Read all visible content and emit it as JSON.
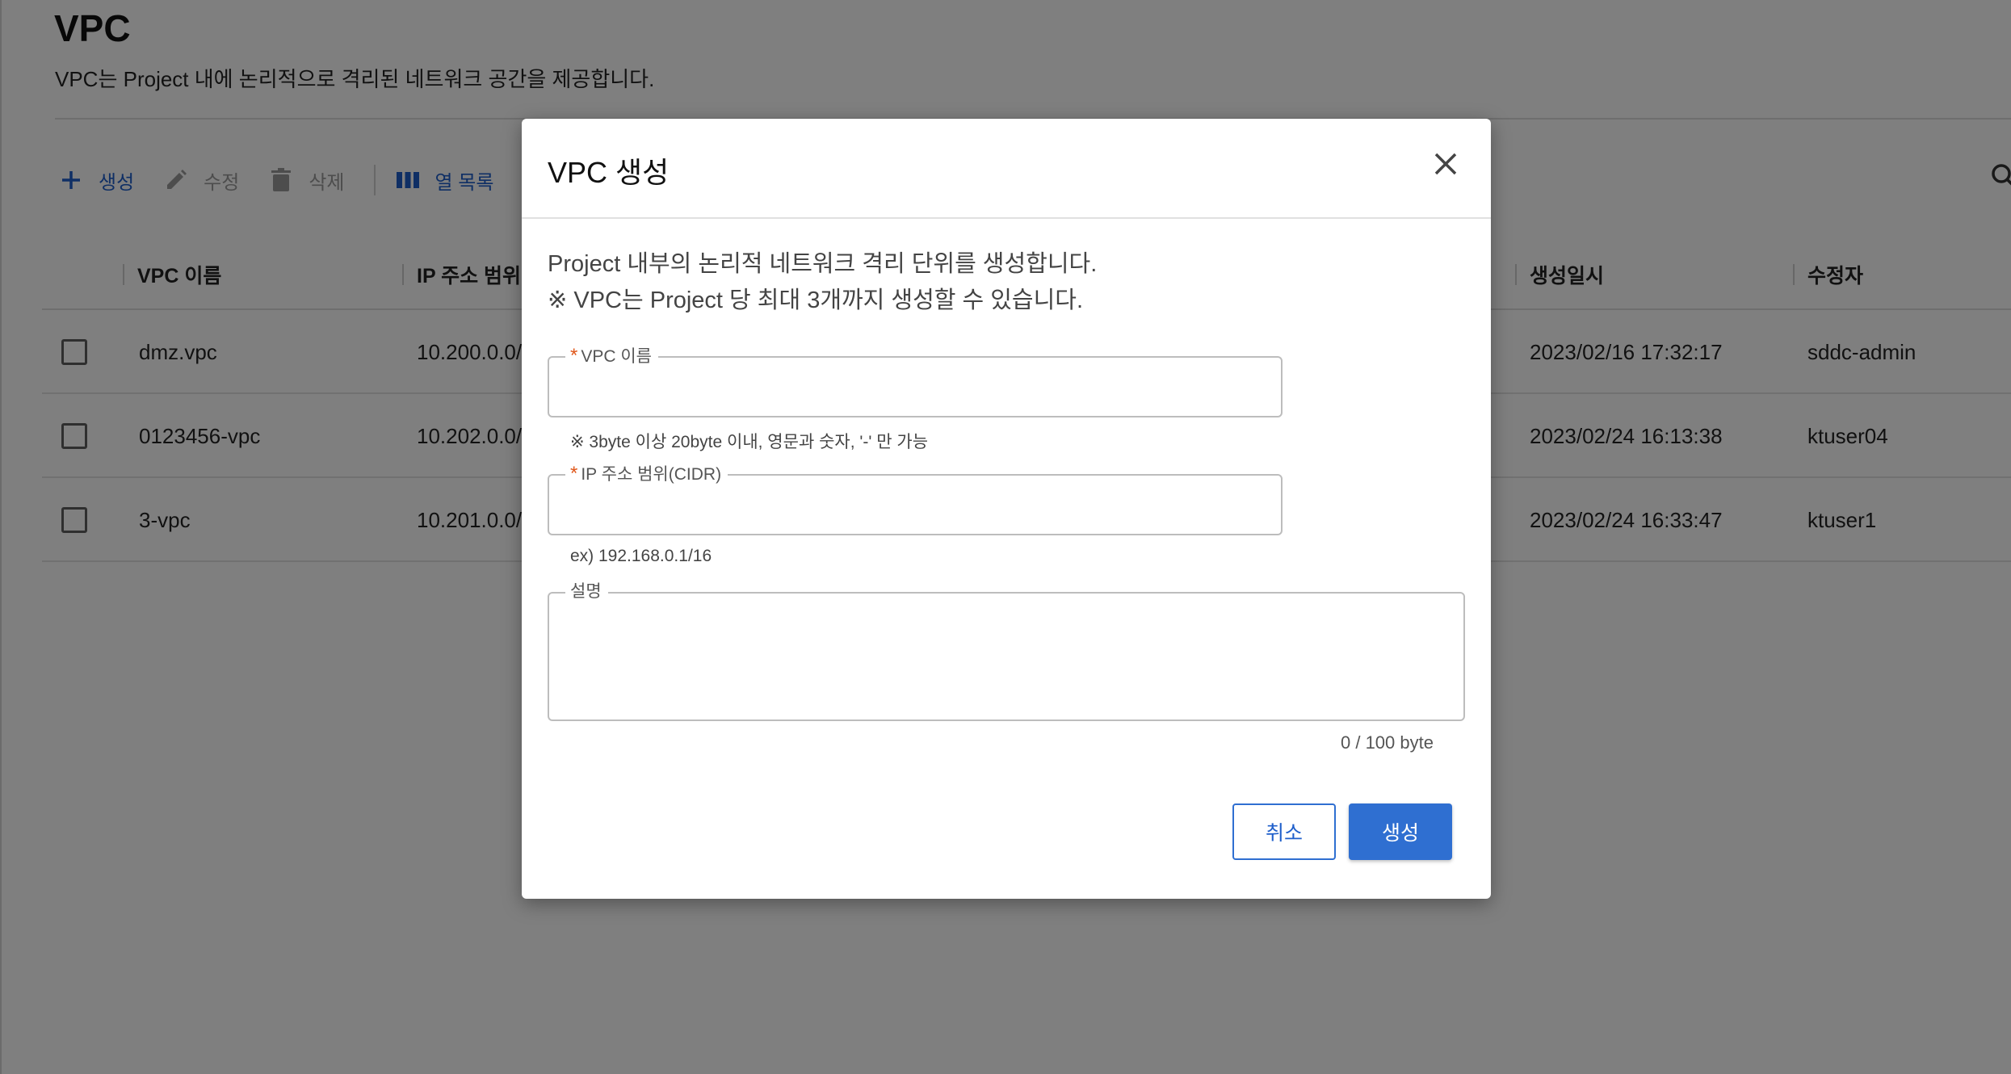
{
  "page": {
    "title": "VPC",
    "description": "VPC는 Project 내에 논리적으로 격리된 네트워크 공간을 제공합니다."
  },
  "toolbar": {
    "create_label": "생성",
    "edit_label": "수정",
    "delete_label": "삭제",
    "columns_label": "열 목록",
    "icons": {
      "create": "plus-icon",
      "edit": "pencil-icon",
      "delete": "trash-icon",
      "columns": "columns-icon",
      "filter": "filter-icon",
      "search": "search-icon"
    }
  },
  "table": {
    "headers": [
      "VPC 이름",
      "IP 주소 범위",
      "생성일시",
      "수정자"
    ],
    "rows": [
      {
        "name": "dmz.vpc",
        "cidr": "10.200.0.0/",
        "created": "2023/02/16 17:32:17",
        "modifier": "sddc-admin"
      },
      {
        "name": "0123456-vpc",
        "cidr": "10.202.0.0/",
        "created": "2023/02/24 16:13:38",
        "modifier": "ktuser04"
      },
      {
        "name": "3-vpc",
        "cidr": "10.201.0.0/",
        "created": "2023/02/24 16:33:47",
        "modifier": "ktuser1"
      }
    ]
  },
  "modal": {
    "title": "VPC 생성",
    "intro_line1": "Project 내부의 논리적 네트워크 격리 단위를 생성합니다.",
    "intro_line2": "※ VPC는 Project 당 최대 3개까지 생성할 수 있습니다.",
    "required_mark": "*",
    "vpc_name": {
      "label": "VPC 이름",
      "value": "",
      "helper": "※ 3byte 이상 20byte 이내, 영문과 숫자, '-' 만 가능"
    },
    "cidr": {
      "label": "IP 주소 범위(CIDR)",
      "value": "",
      "helper": "ex) 192.168.0.1/16"
    },
    "description": {
      "label": "설명",
      "value": "",
      "counter": "0 / 100 byte"
    },
    "cancel_label": "취소",
    "create_label": "생성"
  },
  "colors": {
    "accent": "#2f6fd1",
    "required": "#e0581c",
    "overlay": "rgba(0,0,0,0.5)"
  }
}
